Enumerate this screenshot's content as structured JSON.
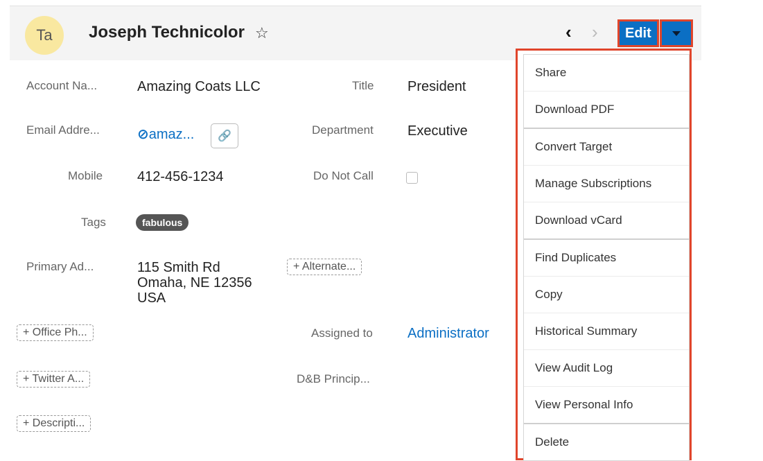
{
  "header": {
    "avatar_initials": "Ta",
    "record_name": "Joseph Technicolor",
    "edit_label": "Edit"
  },
  "fields": {
    "account_name_label": "Account Na...",
    "account_name_value": "Amazing Coats LLC",
    "title_label": "Title",
    "title_value": "President",
    "email_label": "Email Addre...",
    "email_value": "amaz...",
    "department_label": "Department",
    "department_value": "Executive",
    "mobile_label": "Mobile",
    "mobile_value": "412-456-1234",
    "do_not_call_label": "Do Not Call",
    "tags_label": "Tags",
    "tag_value": "fabulous",
    "primary_address_label": "Primary Ad...",
    "address_line1": "115 Smith Rd",
    "address_line2": "Omaha, NE 12356",
    "address_line3": "USA",
    "alternate_button": "+ Alternate...",
    "office_phone_button": "+ Office Ph...",
    "assigned_to_label": "Assigned to",
    "assigned_to_value": "Administrator",
    "twitter_button": "+ Twitter A...",
    "dnb_label": "D&B Princip...",
    "description_button": "+ Descripti..."
  },
  "menu": {
    "items": [
      {
        "label": "Share"
      },
      {
        "label": "Download PDF"
      },
      {
        "label": "Convert Target"
      },
      {
        "label": "Manage Subscriptions"
      },
      {
        "label": "Download vCard"
      },
      {
        "label": "Find Duplicates"
      },
      {
        "label": "Copy"
      },
      {
        "label": "Historical Summary"
      },
      {
        "label": "View Audit Log"
      },
      {
        "label": "View Personal Info"
      },
      {
        "label": "Delete"
      }
    ]
  },
  "colors": {
    "accent": "#0b6fc4",
    "highlight": "#e0452b",
    "avatar_bg": "#f9e8a0"
  },
  "icons": {
    "star": "star-icon",
    "prev": "chevron-left-icon",
    "next": "chevron-right-icon",
    "caret": "caret-down-icon",
    "email_opt_out": "prohibited-icon",
    "copy_link": "link-icon"
  }
}
